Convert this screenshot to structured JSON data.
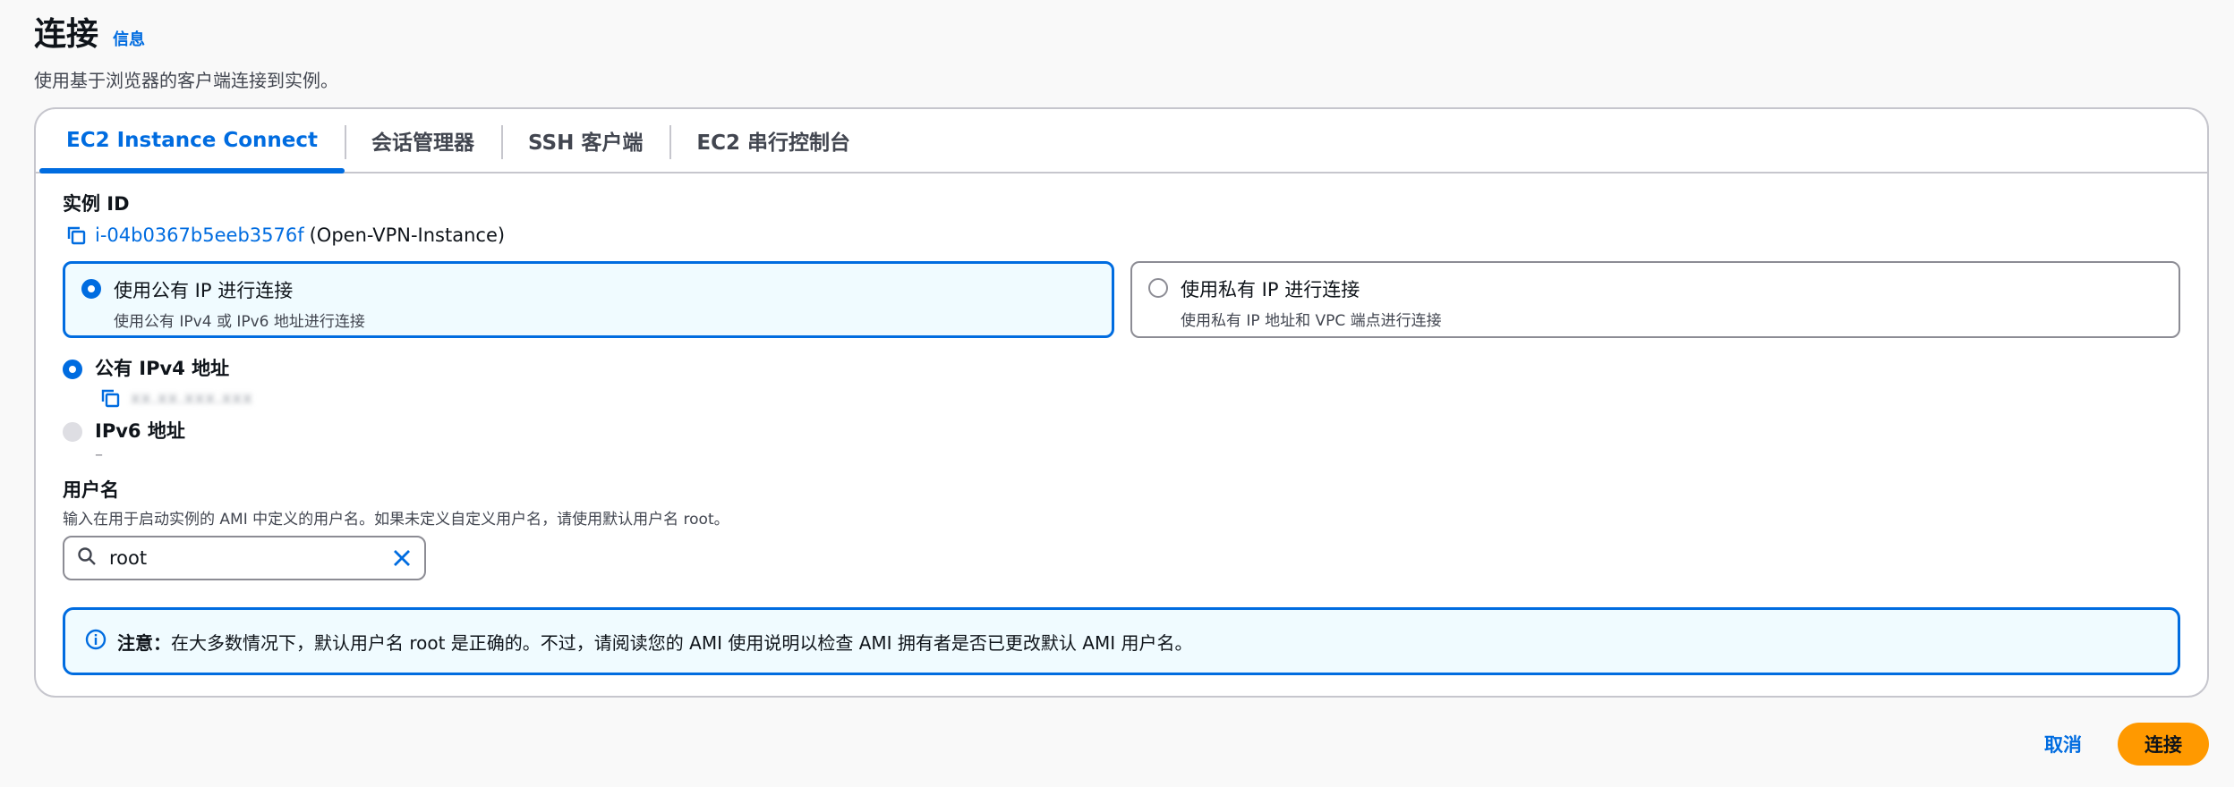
{
  "header": {
    "title": "连接",
    "info_link": "信息",
    "description": "使用基于浏览器的客户端连接到实例。"
  },
  "tabs": [
    {
      "label": "EC2 Instance Connect",
      "active": true
    },
    {
      "label": "会话管理器",
      "active": false
    },
    {
      "label": "SSH 客户端",
      "active": false
    },
    {
      "label": "EC2 串行控制台",
      "active": false
    }
  ],
  "instance": {
    "label": "实例 ID",
    "id": "i-04b0367b5eeb3576f",
    "name": "(Open-VPN-Instance)"
  },
  "connection_type": {
    "public": {
      "title": "使用公有 IP 进行连接",
      "subtitle": "使用公有 IPv4 或 IPv6 地址进行连接",
      "selected": true
    },
    "private": {
      "title": "使用私有 IP 进行连接",
      "subtitle": "使用私有 IP 地址和 VPC 端点进行连接",
      "selected": false
    }
  },
  "addresses": {
    "ipv4": {
      "label": "公有 IPv4 地址",
      "value": "xx.xx.xxx.xxx",
      "selected": true
    },
    "ipv6": {
      "label": "IPv6 地址",
      "value": "–",
      "disabled": true
    }
  },
  "username": {
    "label": "用户名",
    "description": "输入在用于启动实例的 AMI 中定义的用户名。如果未定义自定义用户名，请使用默认用户名 root。",
    "value": "root"
  },
  "alert": {
    "label": "注意：",
    "text": "在大多数情况下，默认用户名 root 是正确的。不过，请阅读您的 AMI 使用说明以检查 AMI 拥有者是否已更改默认 AMI 用户名。"
  },
  "footer": {
    "cancel_label": "取消",
    "connect_label": "连接"
  },
  "colors": {
    "accent": "#006ce0",
    "primary_button": "#ff9900",
    "selected_bg": "#f0fbff"
  }
}
